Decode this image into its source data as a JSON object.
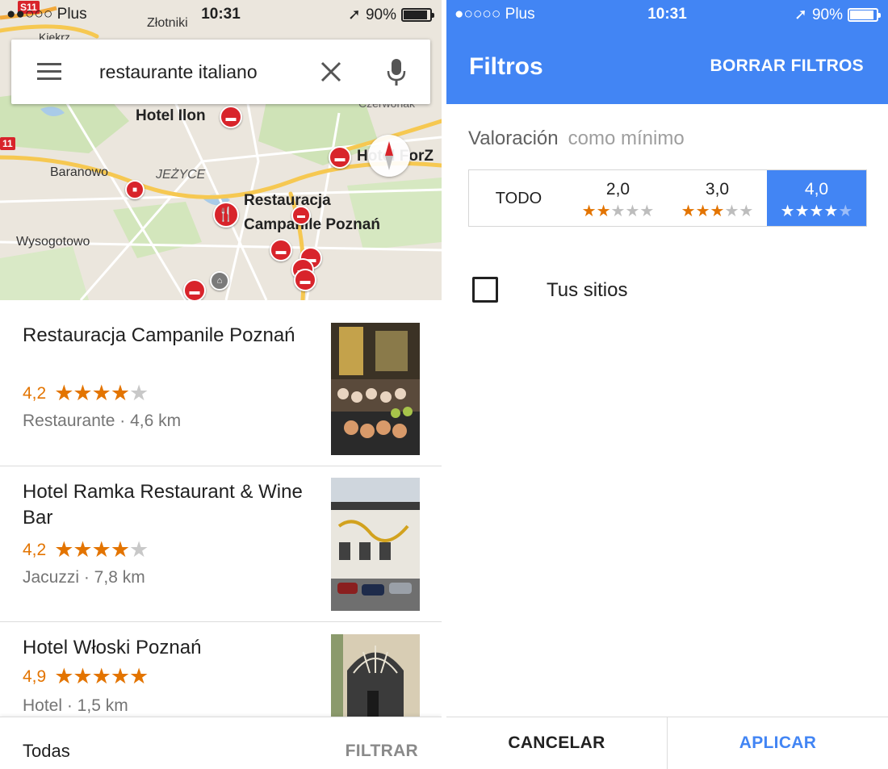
{
  "left": {
    "status": {
      "carrier": "●●○○○ Plus",
      "time": "10:31",
      "battery": "90%"
    },
    "search": {
      "query": "restaurante italiano"
    },
    "map_labels": {
      "zlotniki": "Złotniki",
      "kiekrz": "Kiekrz",
      "hotel_ilon": "Hotel Ilon",
      "hotel_forz": "Hotel ForZ",
      "baranowo": "Baranowo",
      "jezyce": "JEŻYCE",
      "campanile_1": "Restauracja",
      "campanile_2": "Campanile Poznań",
      "wysogotowo": "Wysogotowo",
      "road_s11": "S11",
      "road_11": "11",
      "road_czerwonak": "Czerwonak"
    },
    "results": [
      {
        "name": "Restauracja Campanile Poznań",
        "rating": "4,2",
        "rating_value": 4.2,
        "meta": "Restaurante · 4,6 km"
      },
      {
        "name": "Hotel Ramka Restaurant & Wine Bar",
        "rating": "4,2",
        "rating_value": 4.2,
        "meta": "Jacuzzi · 7,8 km"
      },
      {
        "name": "Hotel Włoski Poznań",
        "rating": "4,9",
        "rating_value": 4.9,
        "meta": "Hotel · 1,5 km"
      }
    ],
    "footer": {
      "all": "Todas",
      "filter": "FILTRAR"
    }
  },
  "right": {
    "status": {
      "carrier": "●○○○○ Plus",
      "time": "10:31",
      "battery": "90%"
    },
    "header": {
      "title": "Filtros",
      "clear": "BORRAR FILTROS"
    },
    "rating": {
      "label": "Valoración",
      "sub": "como mínimo",
      "options": [
        {
          "label": "TODO"
        },
        {
          "label": "2,0",
          "stars": 2
        },
        {
          "label": "3,0",
          "stars": 3
        },
        {
          "label": "4,0",
          "stars": 4
        }
      ],
      "selected": "4,0"
    },
    "your_places": {
      "label": "Tus sitios",
      "checked": false
    },
    "footer": {
      "cancel": "CANCELAR",
      "apply": "APLICAR"
    }
  },
  "colors": {
    "accent": "#4285f4",
    "star": "#e37400",
    "pin": "#d8242b"
  }
}
